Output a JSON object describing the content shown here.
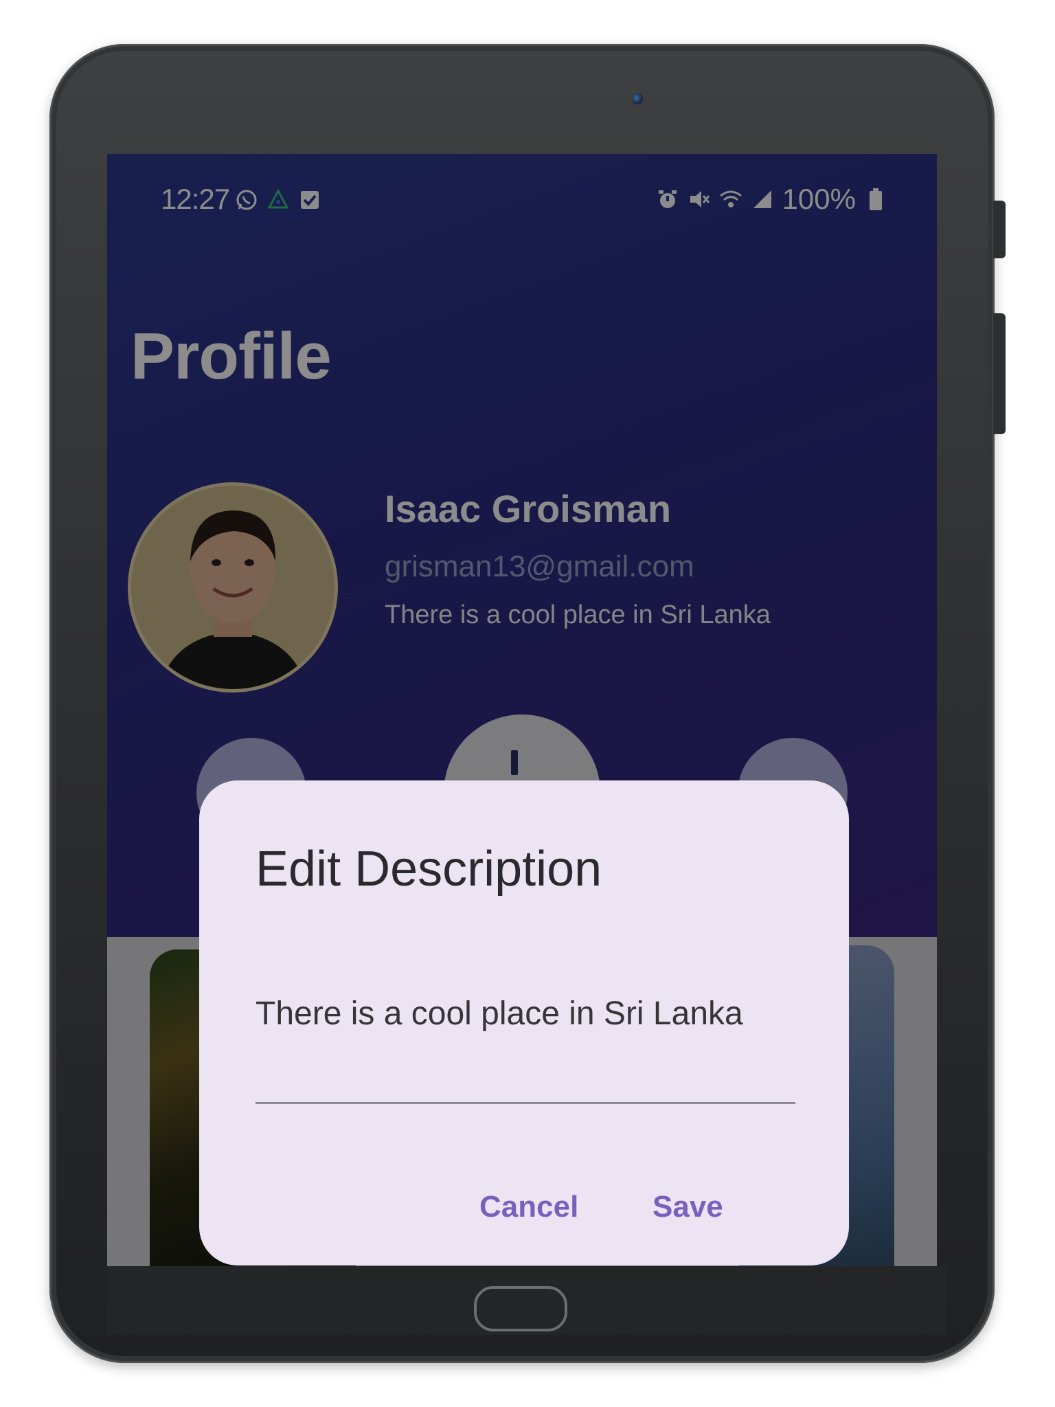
{
  "status_bar": {
    "time": "12:27",
    "left_icons": [
      "whatsapp-icon",
      "app-notification-icon",
      "checkbox-notification-icon"
    ],
    "right_icons": [
      "alarm-icon",
      "mute-icon",
      "wifi-icon",
      "signal-icon"
    ],
    "battery_percent": "100%"
  },
  "header": {
    "title": "Profile"
  },
  "profile": {
    "name": "Isaac Groisman",
    "email": "grisman13@gmail.com",
    "description": "There is a cool place in Sri Lanka"
  },
  "dialog": {
    "title": "Edit Description",
    "input_value": "There is a cool place in Sri Lanka",
    "cancel_label": "Cancel",
    "save_label": "Save"
  },
  "colors": {
    "header_gradient_start": "#2b3a8f",
    "header_gradient_end": "#3a2780",
    "dialog_background": "#ece4f2",
    "action_accent": "#7a60bd"
  }
}
